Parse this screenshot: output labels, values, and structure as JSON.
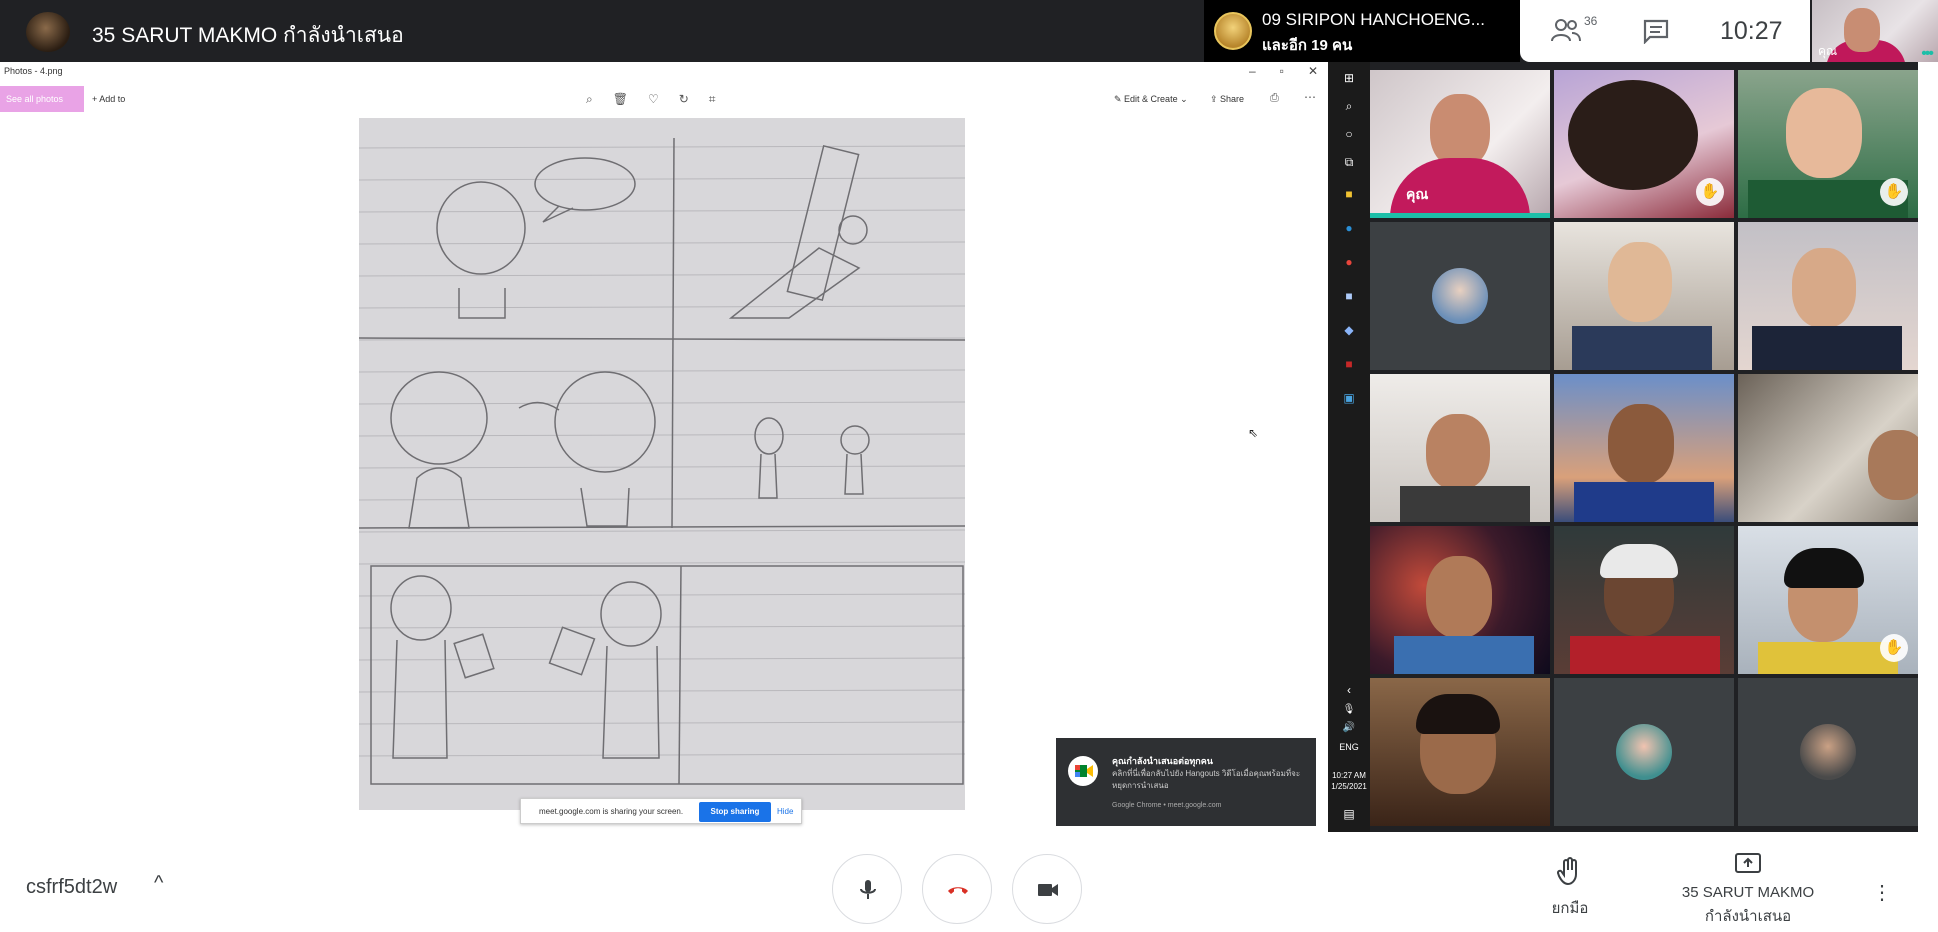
{
  "topbar": {
    "presenting_title": "35 SARUT MAKMO กำลังนำเสนอ",
    "speaker_name": "09 SIRIPON HANCHOENG...",
    "speaker_others": "และอีก 19 คน",
    "people_count": "36",
    "clock": "10:27",
    "self_label": "คุณ"
  },
  "screen": {
    "window_title": "Photos - 4.png",
    "see_all_label": "See all photos",
    "add_to_label": "Add to",
    "edit_create_label": "Edit & Create",
    "share_label": "Share",
    "share_bar": {
      "text": "meet.google.com is sharing your screen.",
      "stop_label": "Stop sharing",
      "hide_label": "Hide"
    },
    "notification": {
      "title": "คุณกำลังนำเสนอต่อทุกคน",
      "body": "คลิกที่นี่เพื่อกลับไปยัง Hangouts วิดีโอเมื่อคุณพร้อมที่จะหยุดการนำเสนอ",
      "footer": "Google Chrome • meet.google.com"
    }
  },
  "taskbar": {
    "lang": "ENG",
    "time": "10:27 AM",
    "date": "1/25/2021"
  },
  "grid": {
    "you_label": "คุณ"
  },
  "bottombar": {
    "meeting_code": "csfrf5dt2w",
    "raise_hand_label": "ยกมือ",
    "presenter_name": "35 SARUT MAKMO",
    "presenter_status": "กำลังนำเสนอ"
  },
  "colors": {
    "accent": "#1a73e8",
    "hangup": "#d93025",
    "active_speaker": "#1cbfa8",
    "see_all_bg": "#e9a3e6"
  },
  "icons": [
    "people-icon",
    "chat-icon",
    "mic-icon",
    "hangup-icon",
    "camera-icon",
    "raise-hand-icon",
    "present-screen-icon",
    "more-icon",
    "chevron-up-icon"
  ]
}
